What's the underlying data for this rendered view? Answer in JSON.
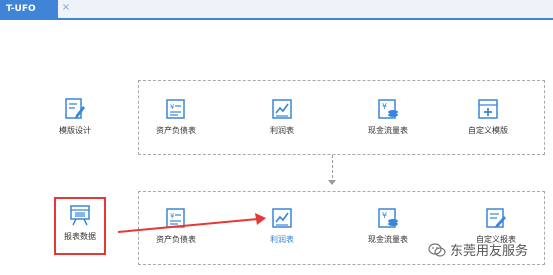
{
  "tab": {
    "label": "T-UFO",
    "close": "×"
  },
  "tiles": {
    "template_design": "模版设计",
    "balance_sheet_top": "资产负债表",
    "income_statement_top": "利润表",
    "cash_flow_top": "现金流量表",
    "custom_template": "自定义模版",
    "report_data": "报表数据",
    "balance_sheet_bottom": "资产负债表",
    "income_statement_bottom": "利润表",
    "cash_flow_bottom": "现金流量表",
    "custom_report": "自定义报表"
  },
  "watermark": {
    "text": "东莞用友服务"
  },
  "colors": {
    "tab": "#3f84d6",
    "icon": "#3a86d8",
    "highlight": "#e53935",
    "active_label": "#2f7fd7"
  }
}
